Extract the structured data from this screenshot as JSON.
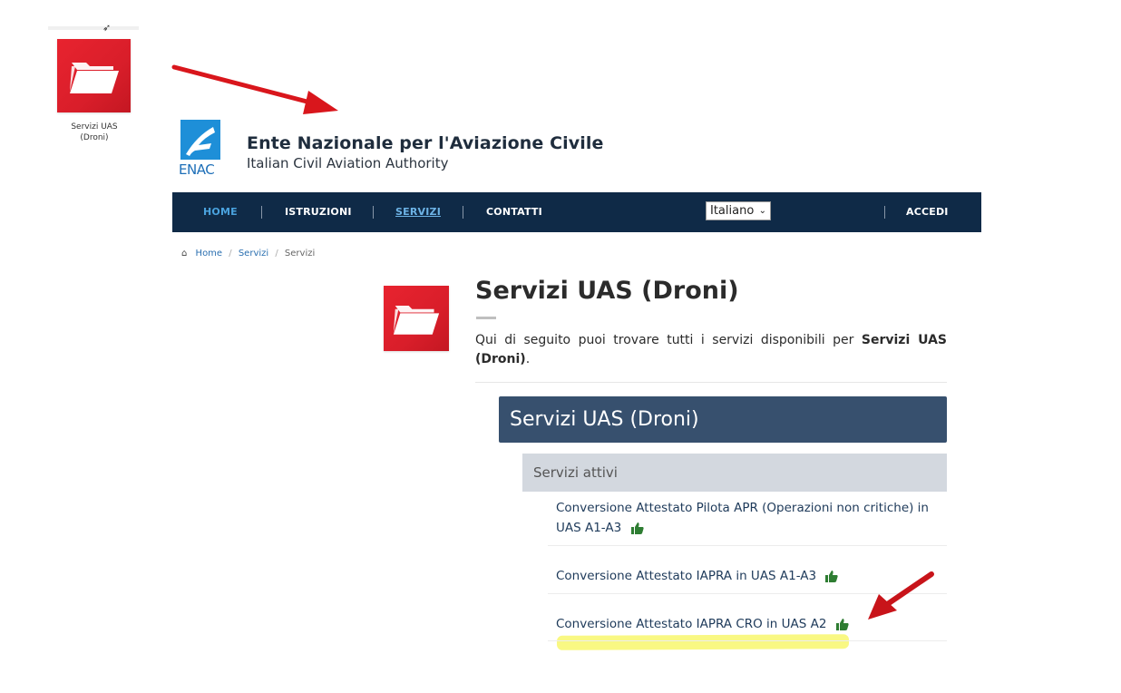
{
  "desktop": {
    "icon_label_line1": "Servizi UAS",
    "icon_label_line2": "(Droni)"
  },
  "header": {
    "logo_text": "ENAC",
    "title": "Ente Nazionale per l'Aviazione Civile",
    "subtitle": "Italian Civil Aviation Authority"
  },
  "nav": {
    "items": [
      {
        "label": "HOME"
      },
      {
        "label": "ISTRUZIONI"
      },
      {
        "label": "SERVIZI"
      },
      {
        "label": "CONTATTI"
      }
    ],
    "language": "Italiano",
    "login": "ACCEDI"
  },
  "breadcrumb": {
    "items": [
      "Home",
      "Servizi",
      "Servizi"
    ]
  },
  "main": {
    "title": "Servizi UAS (Droni)",
    "description_prefix": "Qui di seguito puoi trovare tutti i servizi disponibili per ",
    "description_bold": "Servizi UAS (Droni)",
    "description_suffix": ".",
    "panel_title": "Servizi UAS (Droni)",
    "section_title": "Servizi attivi",
    "services": [
      {
        "label": "Conversione Attestato Pilota APR (Operazioni non critiche) in UAS A1-A3"
      },
      {
        "label": "Conversione Attestato IAPRA in UAS A1-A3"
      },
      {
        "label": "Conversione Attestato IAPRA CRO in UAS A2"
      }
    ]
  },
  "colors": {
    "nav_bg": "#0f2a47",
    "nav_active": "#4aa3df",
    "panel_bg": "#37506e",
    "section_bg": "#d3d8df",
    "folder_red": "#e8232f",
    "thumb_green": "#2e7d32",
    "arrow_red": "#d9161c",
    "highlight_yellow": "#f7f55a"
  }
}
